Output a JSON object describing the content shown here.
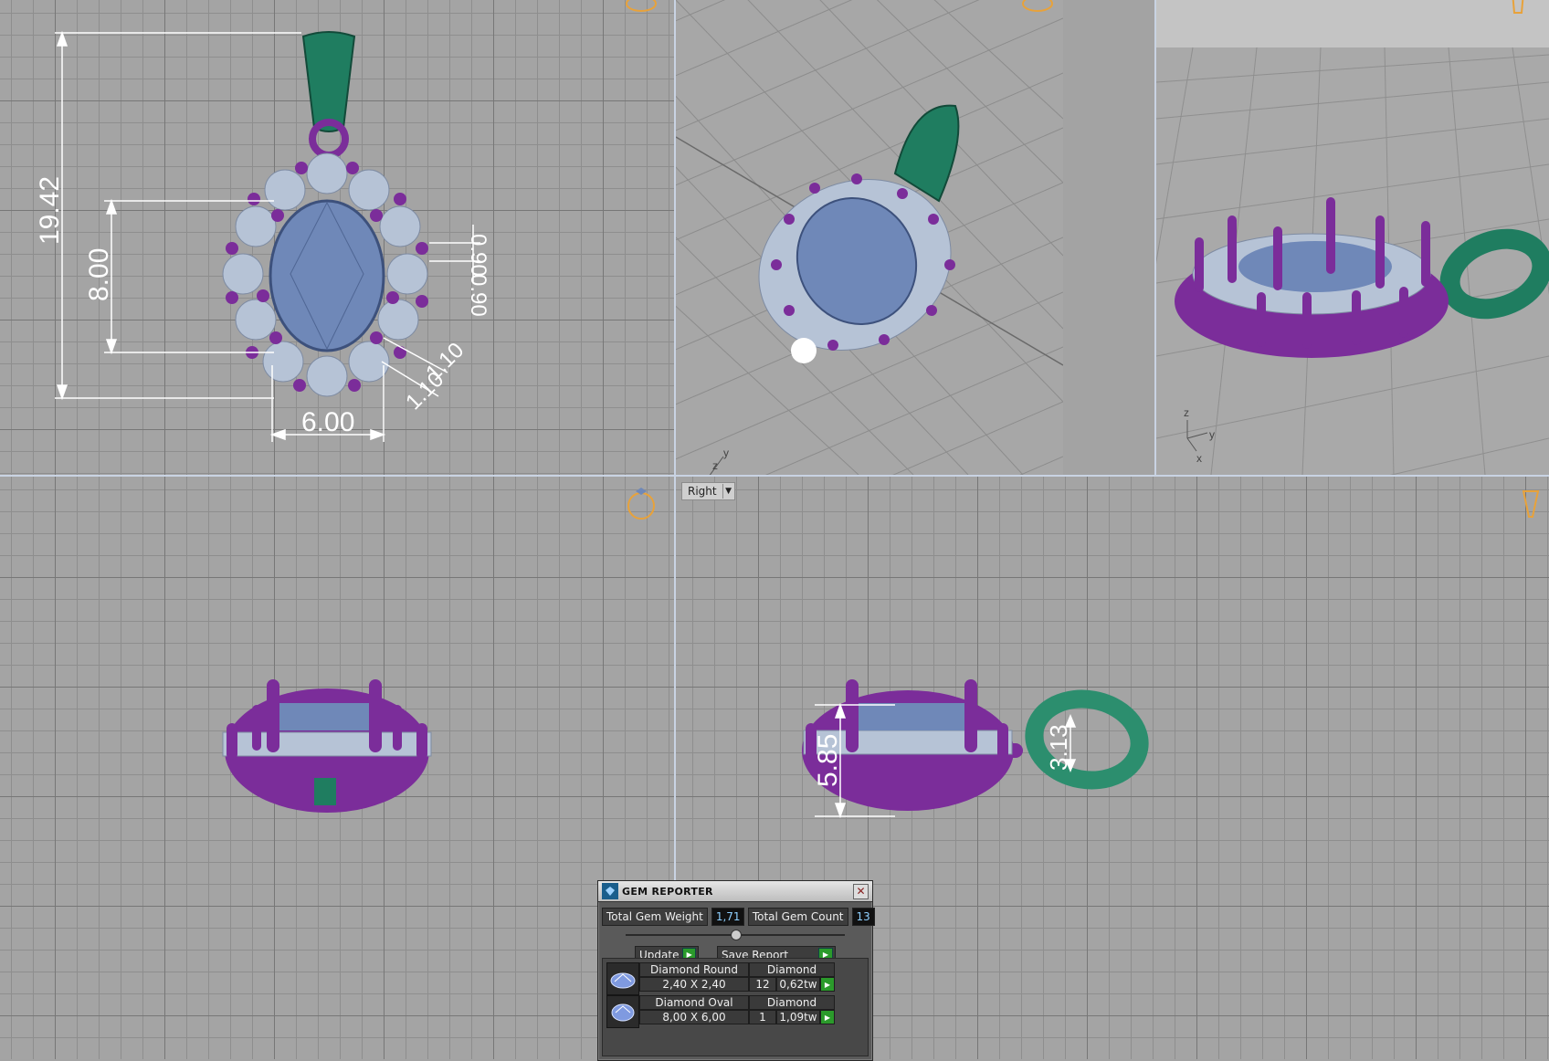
{
  "viewports": {
    "top": {
      "dimensions": {
        "height": "19.42",
        "stone_length": "8.00",
        "stone_width": "6.00",
        "prong": "0.90",
        "prong_b": "0.90",
        "diag_a": "1.10",
        "diag_b": "1.10"
      }
    },
    "perspective": {
      "axes": {
        "x": "x",
        "y": "y",
        "z": "z"
      }
    },
    "angle": {
      "axes": {
        "x": "x",
        "y": "y",
        "z": "z"
      }
    },
    "right": {
      "label": "Right",
      "dimensions": {
        "height": "5.85",
        "bail": "3.13"
      }
    }
  },
  "gem_reporter": {
    "title": "GEM REPORTER",
    "total_weight_label": "Total Gem Weight",
    "total_weight_value": "1,71",
    "total_count_label": "Total Gem Count",
    "total_count_value": "13",
    "update_label": "Update",
    "save_label": "Save Report",
    "gems": [
      {
        "name": "Diamond Round",
        "material": "Diamond",
        "size": "2,40 X 2,40",
        "count": "12",
        "weight": "0,62tw"
      },
      {
        "name": "Diamond Oval",
        "material": "Diamond",
        "size": "8,00 X 6,00",
        "count": "1",
        "weight": "1,09tw"
      }
    ]
  },
  "colors": {
    "metal": "#7b2d9a",
    "bail": "#1f7d60",
    "stone": "#6f88b8",
    "accent": "#2b9a2b"
  }
}
